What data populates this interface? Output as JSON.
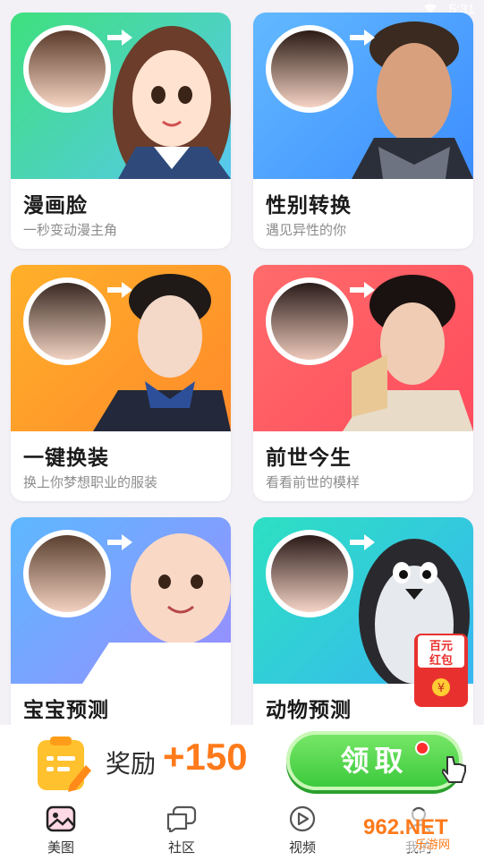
{
  "status": {
    "time": "5:31"
  },
  "cards": [
    {
      "title": "漫画脸",
      "subtitle": "一秒变动漫主角",
      "banner_colors": [
        "#3fe07e",
        "#58c8f0"
      ]
    },
    {
      "title": "性别转换",
      "subtitle": "遇见异性的你",
      "banner_colors": [
        "#62b9ff",
        "#3d8dff"
      ]
    },
    {
      "title": "一键换装",
      "subtitle": "换上你梦想职业的服装",
      "banner_colors": [
        "#ffb02a",
        "#ff8a2a"
      ]
    },
    {
      "title": "前世今生",
      "subtitle": "看看前世的模样",
      "banner_colors": [
        "#ff6b6b",
        "#ff4c5d"
      ]
    },
    {
      "title": "宝宝预测",
      "subtitle": "",
      "banner_colors": [
        "#5db8ff",
        "#9b8cff"
      ]
    },
    {
      "title": "动物预测",
      "subtitle": "",
      "banner_colors": [
        "#2de0c2",
        "#37b7f2"
      ]
    }
  ],
  "reward": {
    "label": "奖励",
    "value": "+150",
    "claim_label": "领取"
  },
  "red_packet": {
    "line1": "百元",
    "line2": "红包",
    "symbol": "¥"
  },
  "tabs": [
    {
      "label": "美图",
      "icon": "photo-icon",
      "active": true
    },
    {
      "label": "社区",
      "icon": "chat-bubble-icon",
      "active": false
    },
    {
      "label": "视频",
      "icon": "play-icon",
      "active": false
    },
    {
      "label": "我的",
      "icon": "user-icon",
      "active": false
    }
  ],
  "watermark": {
    "text": "962.NET",
    "sub": "乐游网"
  },
  "colors": {
    "accent_orange": "#ff7a1a",
    "claim_green": "#39c83a",
    "dot_red": "#ff2d2d"
  }
}
